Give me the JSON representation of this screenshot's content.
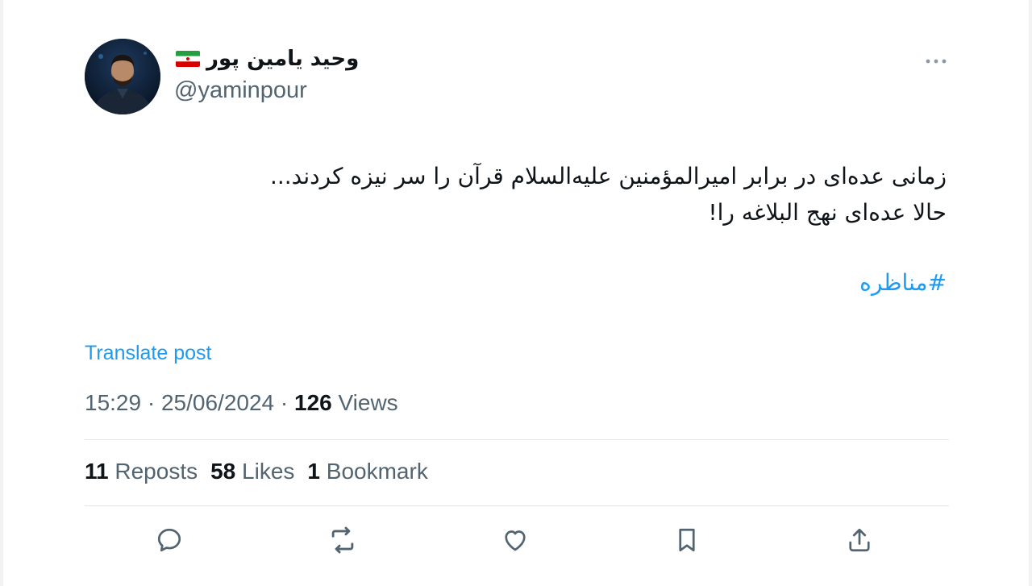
{
  "author": {
    "display_name": "وحید یامین پور",
    "handle": "@yaminpour"
  },
  "icons": {
    "more": "more-horizontal-icon",
    "reply": "reply-icon",
    "repost": "repost-icon",
    "like": "heart-icon",
    "bookmark": "bookmark-icon",
    "share": "share-icon"
  },
  "colors": {
    "link": "#1d9bf0",
    "secondary_text": "#536471",
    "primary_text": "#0f1419"
  },
  "post": {
    "lines": [
      "زمانی عده‌ای در برابر امیرالمؤمنین علیه‌السلام قرآن را سر نیزه کردند...",
      "حالا عده‌ای نهج البلاغه را!"
    ],
    "hashtag": "#مناظره",
    "translate_label": "Translate post"
  },
  "meta": {
    "time": "15:29",
    "separator": "·",
    "date": "25/06/2024",
    "views_count": "126",
    "views_label": "Views"
  },
  "stats": {
    "reposts_count": "11",
    "reposts_label": "Reposts",
    "likes_count": "58",
    "likes_label": "Likes",
    "bookmarks_count": "1",
    "bookmarks_label": "Bookmark"
  }
}
